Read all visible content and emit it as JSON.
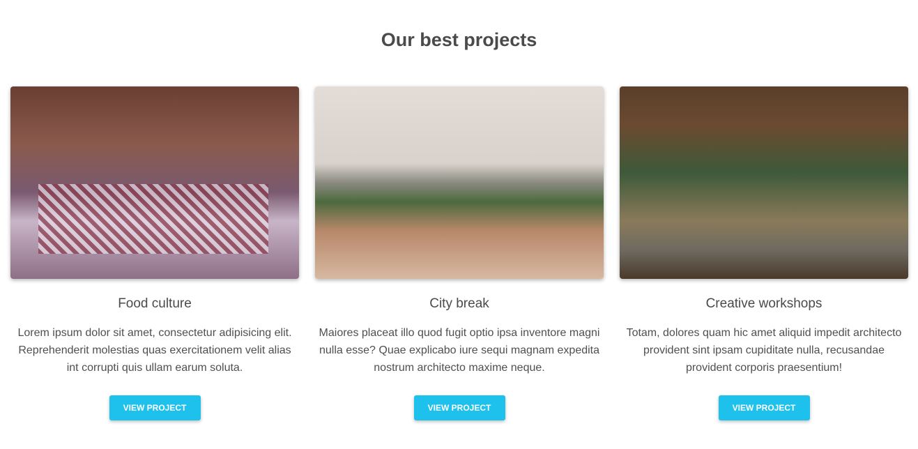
{
  "heading": "Our best projects",
  "projects": [
    {
      "title": "Food culture",
      "description": "Lorem ipsum dolor sit amet, consectetur adipisicing elit. Reprehenderit molestias quas exercitationem velit alias int corrupti quis ullam earum soluta.",
      "button": "VIEW PROJECT"
    },
    {
      "title": "City break",
      "description": "Maiores placeat illo quod fugit optio ipsa inventore magni nulla esse? Quae explicabo iure sequi magnam expedita nostrum architecto maxime neque.",
      "button": "VIEW PROJECT"
    },
    {
      "title": "Creative workshops",
      "description": "Totam, dolores quam hic amet aliquid impedit architecto provident sint ipsam cupiditate nulla, recusandae provident corporis praesentium!",
      "button": "VIEW PROJECT"
    }
  ],
  "colors": {
    "accent": "#1ec1ec"
  }
}
